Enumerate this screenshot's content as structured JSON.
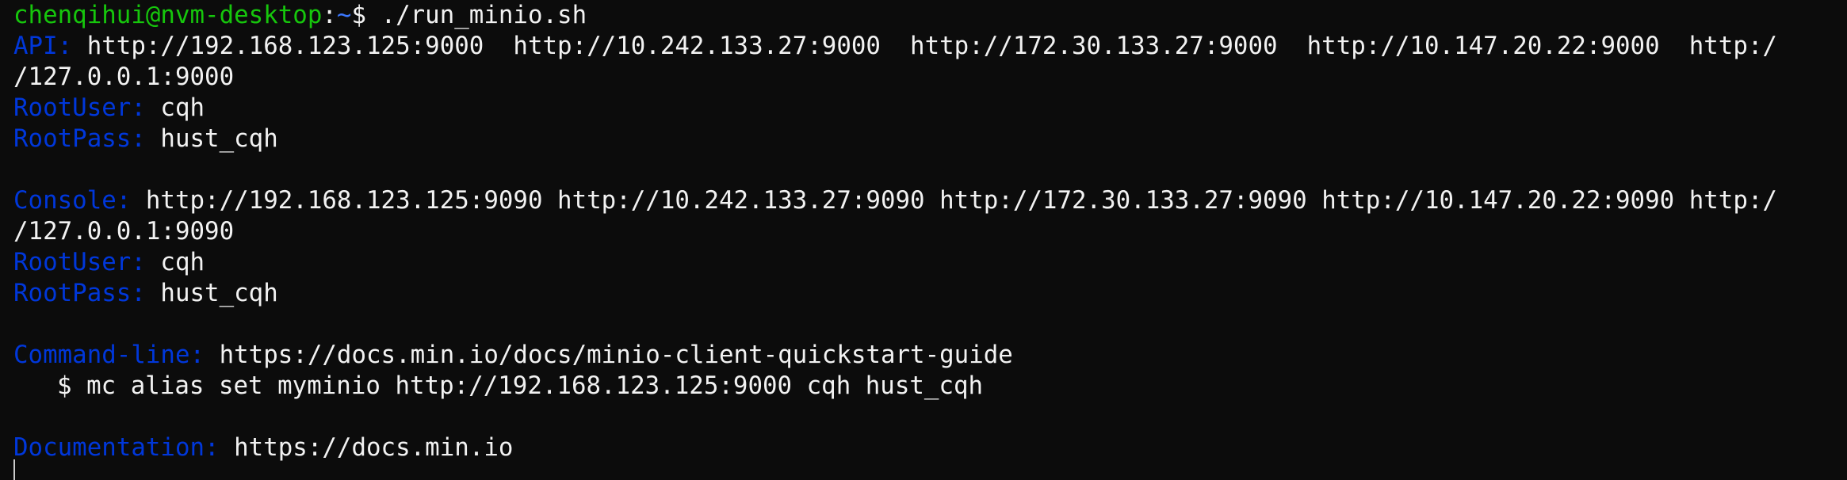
{
  "colors": {
    "background": "#0c0c0c",
    "foreground": "#f2f2f2",
    "prompt_user_host": "#16c60c",
    "prompt_path": "#3b78ff",
    "label": "#0037da"
  },
  "prompt": {
    "user_host": "chenqihui@nvm-desktop",
    "separator": ":",
    "path": "~",
    "symbol": "$ ",
    "command": "./run_minio.sh"
  },
  "api": {
    "label": "API:",
    "value_line1": " http://192.168.123.125:9000  http://10.242.133.27:9000  http://172.30.133.27:9000  http://10.147.20.22:9000  http:/",
    "value_line2": "/127.0.0.1:9000",
    "root_user_label": "RootUser:",
    "root_user_value": " cqh",
    "root_pass_label": "RootPass:",
    "root_pass_value": " hust_cqh"
  },
  "console": {
    "label": "Console:",
    "value_line1": " http://192.168.123.125:9090 http://10.242.133.27:9090 http://172.30.133.27:9090 http://10.147.20.22:9090 http:/",
    "value_line2": "/127.0.0.1:9090",
    "root_user_label": "RootUser:",
    "root_user_value": " cqh",
    "root_pass_label": "RootPass:",
    "root_pass_value": " hust_cqh"
  },
  "command_line": {
    "label": "Command-line:",
    "url": " https://docs.min.io/docs/minio-client-quickstart-guide",
    "example": "$ mc alias set myminio http://192.168.123.125:9000 cqh hust_cqh"
  },
  "documentation": {
    "label": "Documentation:",
    "url": " https://docs.min.io"
  }
}
